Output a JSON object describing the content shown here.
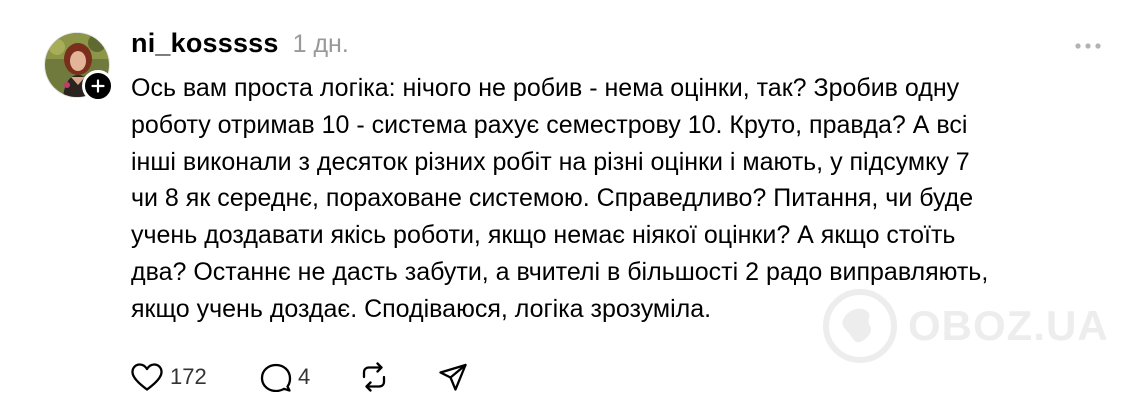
{
  "post": {
    "username": "ni_kosssss",
    "timestamp": "1 дн.",
    "text_lines": [
      "Ось вам проста логіка: нічого не робив - нема оцінки, так? Зробив одну",
      "роботу отримав 10 - система рахує семестрову 10. Круто, правда? А всі",
      "інші виконали з десяток різних робіт на різні оцінки і мають, у підсумку 7",
      "чи 8 як середнє, пораховане системою. Справедливо? Питання, чи буде",
      "учень доздавати якісь роботи, якщо немає ніякої оцінки? А якщо стоїть",
      "два? Останнє не дасть забути, а вчителі в більшості 2 радо виправляють,",
      "якщо учень доздає. Сподіваюся, логіка зрозуміла."
    ],
    "likes": "172",
    "replies": "4"
  },
  "icons": {
    "follow": "plus-icon",
    "more": "more-dots-icon",
    "like": "heart-icon",
    "reply": "comment-bubble-icon",
    "repost": "repost-icon",
    "share": "send-icon"
  },
  "watermark": {
    "text": "OBOZ.UA"
  },
  "colors": {
    "text": "#000000",
    "muted": "#999999",
    "icon": "#000000",
    "watermark": "#ededed"
  }
}
